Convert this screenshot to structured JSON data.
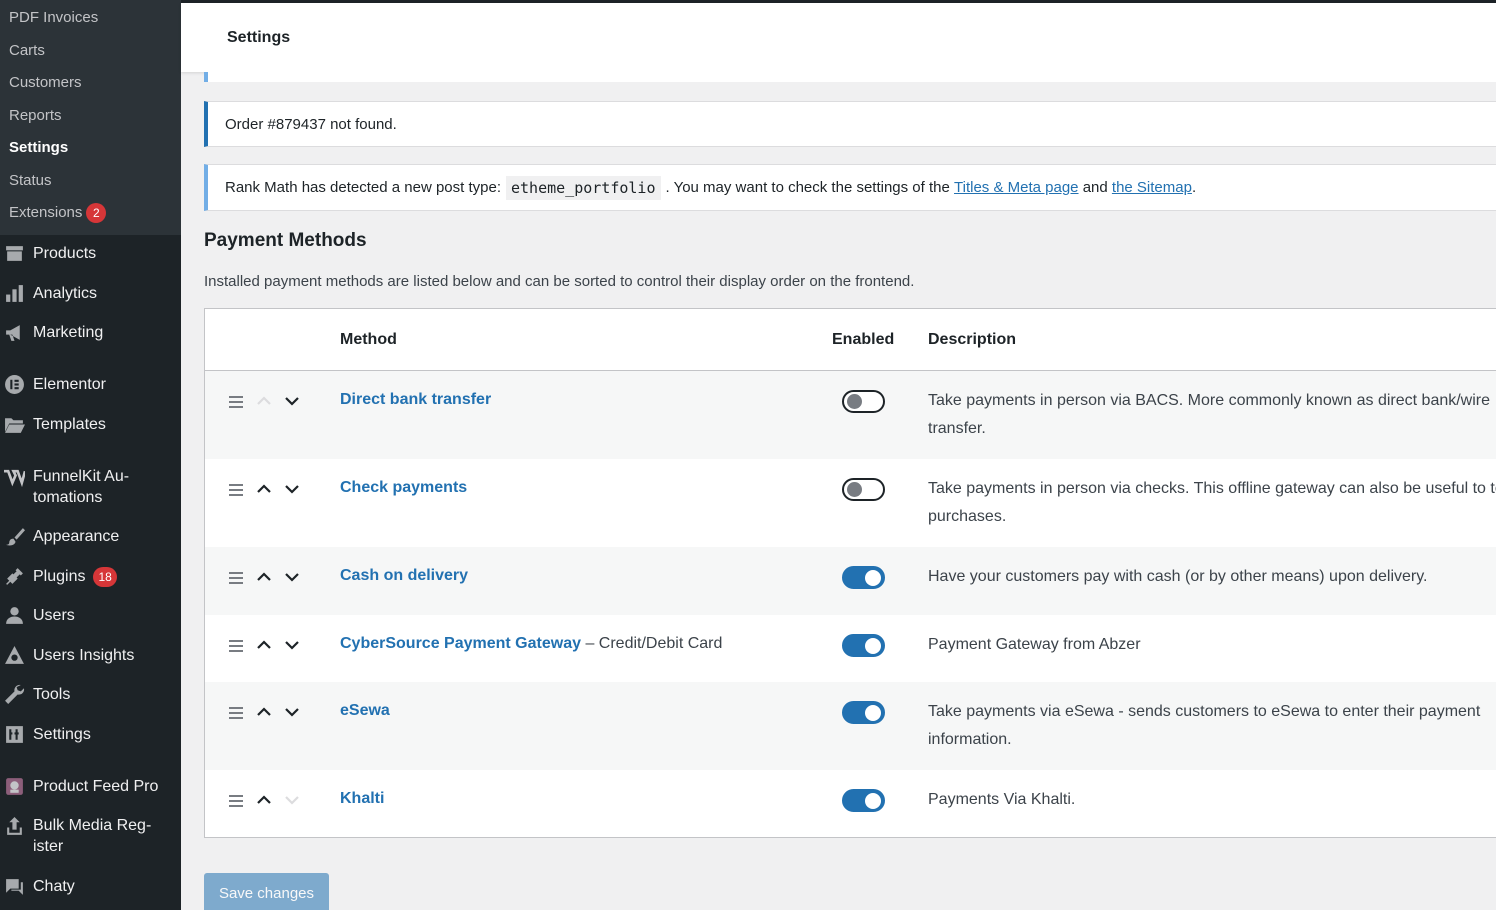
{
  "sidebar": {
    "submenu": [
      {
        "label": "PDF Invoices"
      },
      {
        "label": "Carts"
      },
      {
        "label": "Customers"
      },
      {
        "label": "Reports"
      },
      {
        "label": "Settings",
        "current": true
      },
      {
        "label": "Status"
      },
      {
        "label": "Extensions",
        "badge": "2"
      }
    ],
    "menu": [
      {
        "label": "Products",
        "icon": "archive-icon"
      },
      {
        "label": "Analytics",
        "icon": "bar-chart-icon"
      },
      {
        "label": "Marketing",
        "icon": "megaphone-icon"
      },
      {
        "label": "Elementor",
        "icon": "elementor-icon"
      },
      {
        "label": "Templates",
        "icon": "folder-icon"
      },
      {
        "label": "FunnelKit Au-",
        "label2": "tomations",
        "icon": "funnelkit-icon"
      },
      {
        "label": "Appearance",
        "icon": "paintbrush-icon"
      },
      {
        "label": "Plugins",
        "icon": "plug-icon",
        "badge": "18"
      },
      {
        "label": "Users",
        "icon": "user-icon"
      },
      {
        "label": "Users Insights",
        "icon": "triangle-icon"
      },
      {
        "label": "Tools",
        "icon": "wrench-icon"
      },
      {
        "label": "Settings",
        "icon": "sliders-icon"
      },
      {
        "label": "Product Feed Pro",
        "icon": "feed-icon"
      },
      {
        "label": "Bulk Media Reg-",
        "label2": "ister",
        "icon": "upload-icon"
      },
      {
        "label": "Chaty",
        "icon": "chat-icon"
      }
    ]
  },
  "header": {
    "title": "Settings"
  },
  "notices": {
    "order": "Order #879437 not found.",
    "rankmath_prefix": "Rank Math has detected a new post type:",
    "rankmath_code": "etheme_portfolio",
    "rankmath_mid": ". You may want to check the settings of the",
    "rankmath_link1": "Titles & Meta page",
    "rankmath_and": "and",
    "rankmath_link2": "the Sitemap",
    "rankmath_end": "."
  },
  "section": {
    "title": "Payment Methods",
    "description": "Installed payment methods are listed below and can be sorted to control their display order on the frontend."
  },
  "table": {
    "headers": {
      "method": "Method",
      "enabled": "Enabled",
      "description": "Description"
    },
    "rows": [
      {
        "name": "Direct bank transfer",
        "suffix": "",
        "enabled": false,
        "desc1": "Take payments in person via BACS. More commonly known as direct bank/wire",
        "desc2": "transfer.",
        "up_disabled": true,
        "down_disabled": false
      },
      {
        "name": "Check payments",
        "suffix": "",
        "enabled": false,
        "desc1": "Take payments in person via checks. This offline gateway can also be useful to test",
        "desc2": "purchases.",
        "up_disabled": false,
        "down_disabled": false
      },
      {
        "name": "Cash on delivery",
        "suffix": "",
        "enabled": true,
        "desc1": "Have your customers pay with cash (or by other means) upon delivery.",
        "desc2": "",
        "up_disabled": false,
        "down_disabled": false
      },
      {
        "name": "CyberSource Payment Gateway",
        "suffix": " – Credit/Debit Card",
        "enabled": true,
        "desc1": "Payment Gateway from Abzer",
        "desc2": "",
        "up_disabled": false,
        "down_disabled": false
      },
      {
        "name": "eSewa",
        "suffix": "",
        "enabled": true,
        "desc1": "Take payments via eSewa - sends customers to eSewa to enter their payment",
        "desc2": "information.",
        "up_disabled": false,
        "down_disabled": false
      },
      {
        "name": "Khalti",
        "suffix": "",
        "enabled": true,
        "desc1": "Payments Via Khalti.",
        "desc2": "",
        "up_disabled": false,
        "down_disabled": true
      }
    ]
  },
  "save_label": "Save changes",
  "colors": {
    "accent": "#2271b1",
    "sidebar": "#1d2327",
    "submenu": "#2c3338",
    "badge": "#d63638"
  }
}
